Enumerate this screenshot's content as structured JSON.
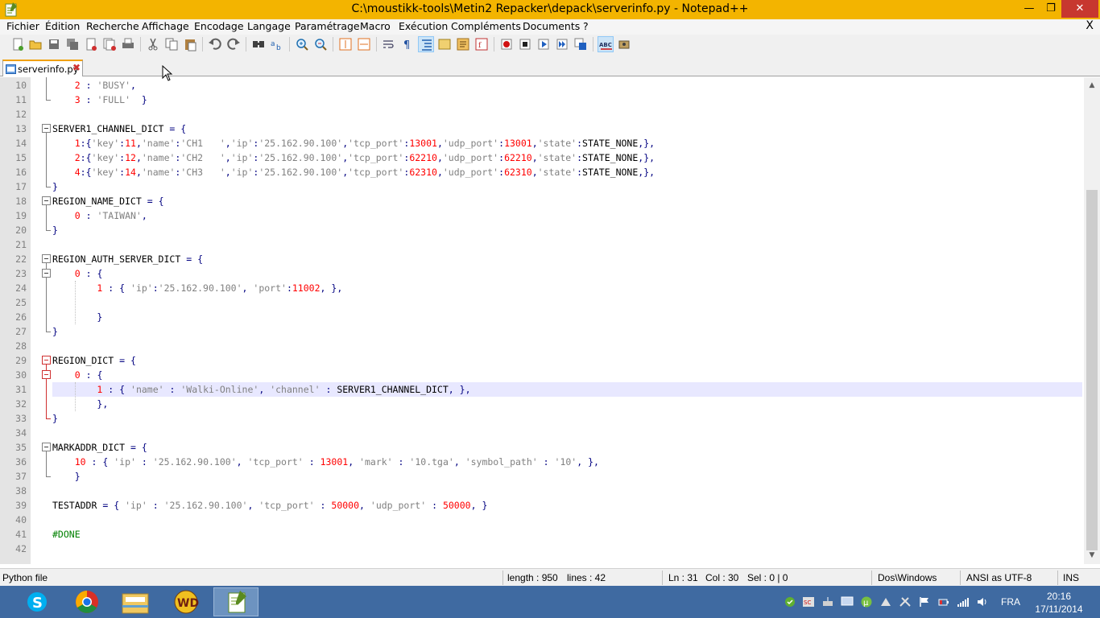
{
  "window": {
    "title": "C:\\moustikk-tools\\Metin2 Repacker\\depack\\serverinfo.py - Notepad++",
    "minimize": "—",
    "maximize": "❐",
    "close": "✕"
  },
  "menu": {
    "items": [
      "Fichier",
      "Édition",
      "Recherche",
      "Affichage",
      "Encodage",
      "Langage",
      "Paramétrage",
      "Macro",
      "Exécution",
      "Compléments",
      "Documents",
      "?"
    ],
    "close": "X"
  },
  "tab": {
    "label": "serverinfo.py",
    "close": "✖"
  },
  "code_lines": [
    {
      "n": "10",
      "t": "    2 : 'BUSY',"
    },
    {
      "n": "11",
      "t": "    3 : 'FULL'  }"
    },
    {
      "n": "12",
      "t": ""
    },
    {
      "n": "13",
      "t": "SERVER1_CHANNEL_DICT = {"
    },
    {
      "n": "14",
      "t": "    1:{'key':11,'name':'CH1   ','ip':'25.162.90.100','tcp_port':13001,'udp_port':13001,'state':STATE_NONE,},"
    },
    {
      "n": "15",
      "t": "    2:{'key':12,'name':'CH2   ','ip':'25.162.90.100','tcp_port':62210,'udp_port':62210,'state':STATE_NONE,},"
    },
    {
      "n": "16",
      "t": "    4:{'key':14,'name':'CH3   ','ip':'25.162.90.100','tcp_port':62310,'udp_port':62310,'state':STATE_NONE,},"
    },
    {
      "n": "17",
      "t": "}"
    },
    {
      "n": "18",
      "t": "REGION_NAME_DICT = {"
    },
    {
      "n": "19",
      "t": "    0 : 'TAIWAN',"
    },
    {
      "n": "20",
      "t": "}"
    },
    {
      "n": "21",
      "t": ""
    },
    {
      "n": "22",
      "t": "REGION_AUTH_SERVER_DICT = {"
    },
    {
      "n": "23",
      "t": "    0 : {"
    },
    {
      "n": "24",
      "t": "        1 : { 'ip':'25.162.90.100', 'port':11002, },"
    },
    {
      "n": "25",
      "t": ""
    },
    {
      "n": "26",
      "t": "        }"
    },
    {
      "n": "27",
      "t": "}"
    },
    {
      "n": "28",
      "t": ""
    },
    {
      "n": "29",
      "t": "REGION_DICT = {"
    },
    {
      "n": "30",
      "t": "    0 : {"
    },
    {
      "n": "31",
      "t": "        1 : { 'name' : 'Walki-Online', 'channel' : SERVER1_CHANNEL_DICT, },"
    },
    {
      "n": "32",
      "t": "        },"
    },
    {
      "n": "33",
      "t": "}"
    },
    {
      "n": "34",
      "t": ""
    },
    {
      "n": "35",
      "t": "MARKADDR_DICT = {"
    },
    {
      "n": "36",
      "t": "    10 : { 'ip' : '25.162.90.100', 'tcp_port' : 13001, 'mark' : '10.tga', 'symbol_path' : '10', },"
    },
    {
      "n": "37",
      "t": "    }"
    },
    {
      "n": "38",
      "t": ""
    },
    {
      "n": "39",
      "t": "TESTADDR = { 'ip' : '25.162.90.100', 'tcp_port' : 50000, 'udp_port' : 50000, }"
    },
    {
      "n": "40",
      "t": ""
    },
    {
      "n": "41",
      "t": "#DONE"
    },
    {
      "n": "42",
      "t": ""
    }
  ],
  "current_line": "31",
  "status": {
    "filetype": "Python file",
    "length": "length : 950",
    "lines": "lines : 42",
    "ln": "Ln : 31",
    "col": "Col : 30",
    "sel": "Sel : 0 | 0",
    "eol": "Dos\\Windows",
    "encoding": "ANSI as UTF-8",
    "mode": "INS"
  },
  "taskbar": {
    "language": "FRA",
    "time": "20:16",
    "date": "17/11/2014"
  },
  "colors": {
    "titlebar": "#f3b400",
    "taskbar": "#3f6aa1",
    "keyword": "#000080",
    "number": "#ff0000",
    "string": "#808080",
    "comment": "#008000"
  }
}
